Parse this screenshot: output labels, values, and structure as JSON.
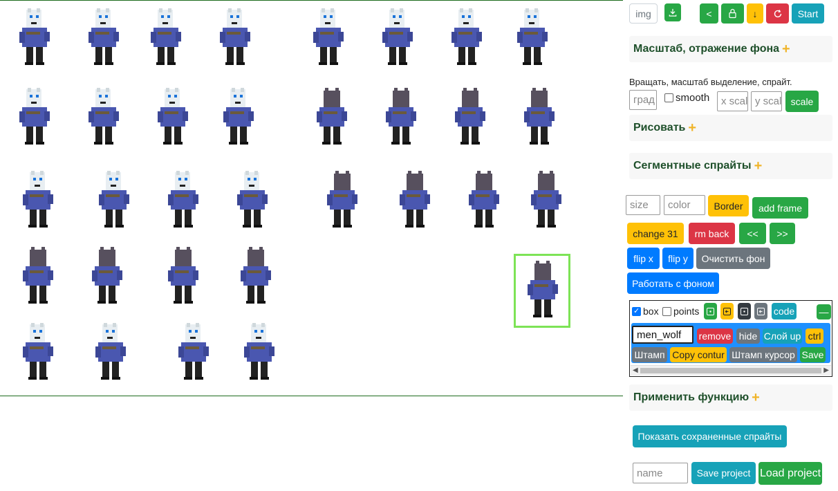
{
  "toolbar": {
    "img_label": "img",
    "download_icon": "download-icon",
    "back_label": "<",
    "lock_icon": "lock-icon",
    "down_label": "↓",
    "refresh_icon": "refresh-icon",
    "start_label": "Start"
  },
  "sections": {
    "scale": "Масштаб, отражение фона",
    "draw": "Рисовать",
    "segment": "Сегментные спрайты",
    "apply": "Применить функцию",
    "plus": "+"
  },
  "rotate": {
    "hint": "Вращать, масштаб выделение, спрайт.",
    "deg_placeholder": "град",
    "smooth_label": "smooth",
    "x_placeholder": "x scale",
    "y_placeholder": "y scale",
    "scale_label": "scale"
  },
  "segment": {
    "size_placeholder": "size",
    "color_placeholder": "color",
    "border_label": "Border",
    "add_frame_label": "add frame",
    "change_label": "change 31",
    "rm_back_label": "rm back",
    "prev_label": "<<",
    "next_label": ">>",
    "flip_x_label": "flip x",
    "flip_y_label": "flip y",
    "clear_bg_label": "Очистить фон",
    "work_bg_label": "Работать с фоном"
  },
  "layer_panel": {
    "box_label": "box",
    "points_label": "points",
    "code_label": "code",
    "minimize_label": "—",
    "name_value": "men_wolf",
    "remove_label": "remove",
    "hide_label": "hide",
    "layer_up_label": "Слой up",
    "ctrl_label": "ctrl",
    "stamp_label": "Штамп",
    "copy_contour_label": "Copy contur",
    "stamp_cursor_label": "Штамп курсор",
    "save_label": "Save"
  },
  "bottom": {
    "show_saved_label": "Показать сохраненные спрайты",
    "name_placeholder": "name",
    "save_project_label": "Save project",
    "load_project_label": "Load project"
  },
  "colors": {
    "green": "#28a745",
    "teal": "#17a2b8",
    "yellow": "#ffc107",
    "red": "#dc3545",
    "blue": "#007bff",
    "gray": "#6c757d",
    "selection": "#7de356"
  }
}
